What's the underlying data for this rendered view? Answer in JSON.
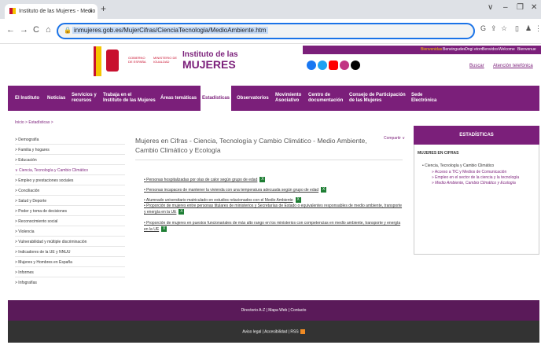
{
  "browser": {
    "tab_title": "Instituto de las Mujeres - Medio",
    "tab_close": "×",
    "new_tab": "+",
    "url": "inmujeres.gob.es/MujerCifras/CienciaTecnologia/MedioAmbiente.htm",
    "nav_back": "←",
    "nav_forward": "→",
    "nav_reload": "C",
    "nav_home": "⌂",
    "url_icons": {
      "google": "G",
      "share": "⇪",
      "star": "☆",
      "sidebar": "▯",
      "profile": "♟",
      "menu": "⋮"
    },
    "window_controls": {
      "collapse": "∨",
      "minimize": "–",
      "restore": "❐",
      "close": "✕"
    }
  },
  "header": {
    "gov_text_1": "GOBIERNO DE ESPAÑA",
    "gov_text_2": "MINISTERIO DE IGUALDAD",
    "logo_line1": "Instituto de las",
    "logo_line2": "MUJERES",
    "languages": [
      "Bienvenidas",
      "Benvingudes",
      "Ongi etorri",
      "Benvidos",
      "Welcome",
      "Bienvenue"
    ],
    "search_link": "Buscar",
    "contact_link": "Atención telefónica"
  },
  "nav": {
    "items": [
      "El Instituto",
      "Noticias",
      "Servicios y\nrecursos",
      "Trabaja en el\nInstituto de las Mujeres",
      "Áreas temáticas",
      "Estadísticas",
      "Observatorios",
      "Movimiento\nAsociativo",
      "Centro de\ndocumentación",
      "Consejo de Participación\nde las Mujeres",
      "Sede\nElectrónica"
    ]
  },
  "breadcrumb": "Inicio > Estadísticas >",
  "sidebar": {
    "items": [
      "> Demografía",
      "> Familia y hogares",
      "> Educación",
      "∨ Ciencia, Tecnología y Cambio Climático",
      "> Empleo y prestaciones sociales",
      "> Conciliación",
      "> Salud y Deporte",
      "> Poder y toma de decisiones",
      "> Reconocimiento social",
      "> Violencia",
      "> Vulnerabilidad y múltiple discriminación",
      "> Indicadores de la UE y NNUU",
      "> Mujeres y Hombres en España",
      "> Informes",
      "> Infografías"
    ]
  },
  "main": {
    "title": "Mujeres en Cifras - Ciencia, Tecnología y Cambio Climático - Medio Ambiente, Cambio Climático y Ecología",
    "share": "Compartir ∨",
    "documents": [
      "Personas hospitalizadas por olas de calor según grupo de edad",
      "Personas incapaces de mantener la vivienda con una temperatura adecuada según grupo de edad",
      "Alumnado universitario matriculado en estudios relacionados con el Medio Ambiente",
      "Proporción de mujeres entre personas titulares de ministerios y Secretarías de Estado o equivalentes responsables de medio ambiente, transporte y energía en la UE",
      "Proporción de mujeres en puestos funcionariales de más alto rango en los ministerios con competencias en medio ambiente, transporte y energía en la UE"
    ],
    "excel_icon": "X"
  },
  "right_box": {
    "header": "ESTADÍSTICAS",
    "section": "MUJERES EN CIFRAS",
    "parent": "Ciencia, Tecnología y Cambio Climático",
    "children": [
      "Acceso a TIC y Medios de Comunicación",
      "Empleo en el sector de la ciencia y la tecnología",
      "Medio Ambiente, Cambio Climático y Ecología"
    ]
  },
  "footer": {
    "links_1": "Directorio A-Z | Mapa Web | Contacto",
    "links_2": "Aviso legal | Accesibilidad | RSS"
  },
  "colors": {
    "brand": "#7b1f7a",
    "footer_dark": "#5a1a59",
    "footer_black": "#333333",
    "excel": "#1e7e34"
  }
}
